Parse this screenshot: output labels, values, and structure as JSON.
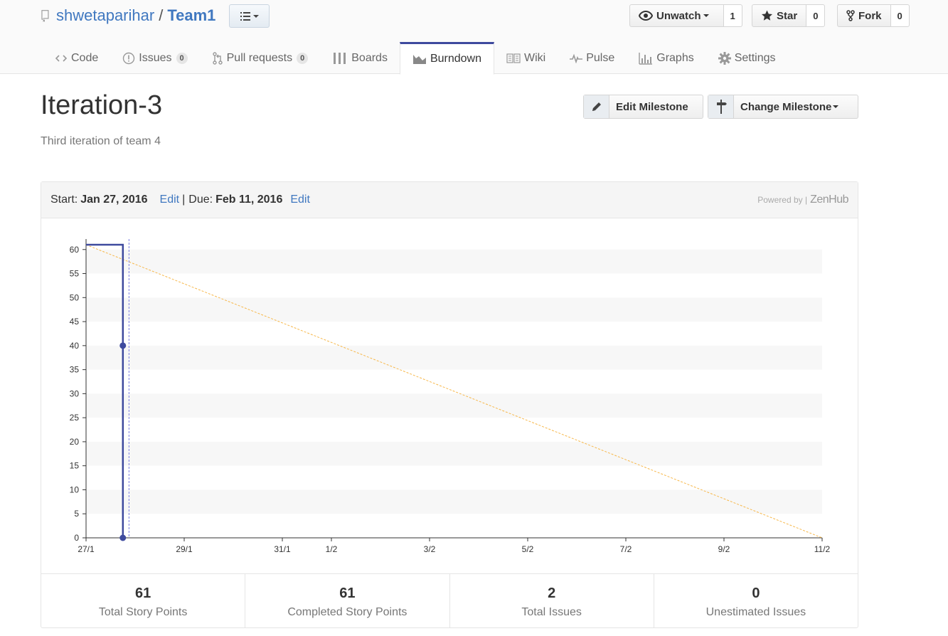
{
  "repo": {
    "owner": "shwetaparihar",
    "separator": "/",
    "name": "Team1"
  },
  "actions": {
    "watch": {
      "label": "Unwatch",
      "count": "1"
    },
    "star": {
      "label": "Star",
      "count": "0"
    },
    "fork": {
      "label": "Fork",
      "count": "0"
    }
  },
  "tabs": [
    {
      "label": "Code",
      "icon": "code-icon"
    },
    {
      "label": "Issues",
      "icon": "issue-icon",
      "badge": "0"
    },
    {
      "label": "Pull requests",
      "icon": "pull-request-icon",
      "badge": "0"
    },
    {
      "label": "Boards",
      "icon": "boards-icon"
    },
    {
      "label": "Burndown",
      "icon": "burndown-icon",
      "selected": true
    },
    {
      "label": "Wiki",
      "icon": "book-icon"
    },
    {
      "label": "Pulse",
      "icon": "pulse-icon"
    },
    {
      "label": "Graphs",
      "icon": "graph-icon"
    },
    {
      "label": "Settings",
      "icon": "gear-icon"
    }
  ],
  "milestone": {
    "title": "Iteration-3",
    "description": "Third iteration of team 4",
    "edit_label": "Edit Milestone",
    "change_label": "Change Milestone"
  },
  "burndown": {
    "start_label": "Start:",
    "start_date": "Jan 27, 2016",
    "edit": "Edit",
    "pipe": "|",
    "due_label": "Due:",
    "due_date": "Feb 11, 2016",
    "powered_by": "Powered by |",
    "powered_brand": "ZenHub"
  },
  "chart_data": {
    "type": "line",
    "x_ticks": [
      "27/1",
      "29/1",
      "31/1",
      "1/2",
      "3/2",
      "5/2",
      "7/2",
      "9/2",
      "11/2"
    ],
    "x_tick_days": [
      0,
      2,
      4,
      5,
      7,
      9,
      11,
      13,
      15
    ],
    "y_ticks": [
      0,
      5,
      10,
      15,
      20,
      25,
      30,
      35,
      40,
      45,
      50,
      55,
      60
    ],
    "ylim": [
      0,
      61
    ],
    "xlim": [
      "27/1",
      "11/2"
    ],
    "grid": "alternating horizontal bands",
    "series": [
      {
        "style": "step-line",
        "color": "#3e4a9e",
        "points": [
          {
            "x": "27/1",
            "y": 61
          },
          {
            "x": "27/1 18:00",
            "y": 61
          },
          {
            "x": "27/1 18:00",
            "y": 40
          },
          {
            "x": "27/1 18:00",
            "y": 0
          }
        ],
        "markers": [
          {
            "x": "27/1 18:00",
            "y": 40
          },
          {
            "x": "27/1 18:00",
            "y": 0
          }
        ]
      },
      {
        "style": "dashed-ideal",
        "color": "#f7b84b",
        "points": [
          {
            "x": "27/1",
            "y": 61
          },
          {
            "x": "11/2",
            "y": 0
          }
        ]
      }
    ],
    "today_marker": {
      "x": "27/1 21:00",
      "color": "#7b7fe0"
    }
  },
  "stats": [
    {
      "value": "61",
      "label": "Total Story Points"
    },
    {
      "value": "61",
      "label": "Completed Story Points"
    },
    {
      "value": "2",
      "label": "Total Issues"
    },
    {
      "value": "0",
      "label": "Unestimated Issues"
    }
  ]
}
